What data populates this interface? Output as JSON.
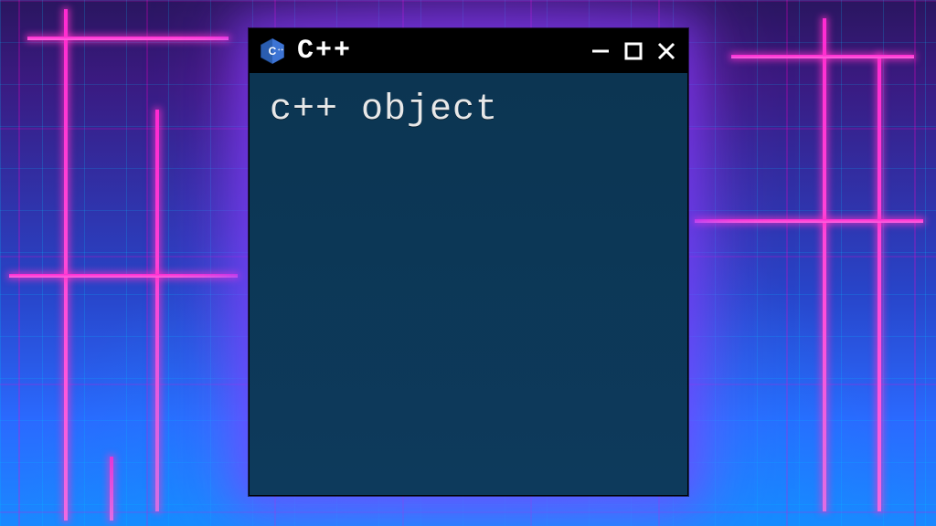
{
  "window": {
    "title": "C++",
    "icon_name": "cpp-hex-icon",
    "controls": {
      "minimize": "minimize",
      "maximize": "maximize",
      "close": "close"
    }
  },
  "content": {
    "text": "c++ object"
  },
  "colors": {
    "titlebar_bg": "#000000",
    "client_bg": "#0d3a5c",
    "text": "#e8e8e8",
    "glow": "#a040ff"
  }
}
